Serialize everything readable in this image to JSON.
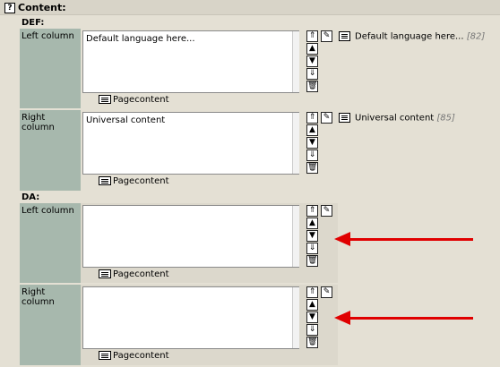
{
  "header": {
    "title": "Content:",
    "help_icon": "?"
  },
  "languages": [
    {
      "code": "DEF:",
      "rows": [
        {
          "label": "Left column",
          "text": "Default language here...",
          "pagecontent": "Pagecontent",
          "preview": "Default language here...",
          "uid": "[82]"
        },
        {
          "label": "Right column",
          "text": "Universal content",
          "pagecontent": "Pagecontent",
          "preview": "Universal content",
          "uid": "[85]"
        }
      ]
    },
    {
      "code": "DA:",
      "rows": [
        {
          "label": "Left column",
          "text": "",
          "pagecontent": "Pagecontent"
        },
        {
          "label": "Right column",
          "text": "",
          "pagecontent": "Pagecontent"
        }
      ]
    }
  ],
  "icons": {
    "move_top": "⇑",
    "move_up": "▲",
    "move_down": "▼",
    "move_bottom": "⇓",
    "delete": "🗑",
    "edit": "✎"
  },
  "colors": {
    "label_bg": "#a7b8ad",
    "panel_bg": "#e4e0d4",
    "arrow": "#e00000"
  }
}
